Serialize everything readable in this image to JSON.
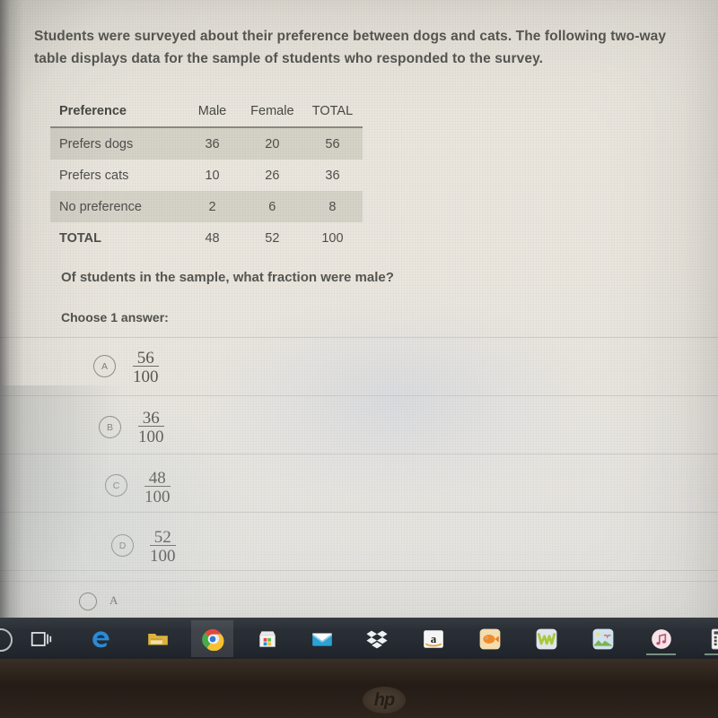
{
  "prompt": "Students were surveyed about their preference between dogs and cats. The following two-way table displays data for the sample of students who responded to the survey.",
  "table": {
    "headers": [
      "Preference",
      "Male",
      "Female",
      "TOTAL"
    ],
    "rows": [
      {
        "label": "Prefers dogs",
        "male": "36",
        "female": "20",
        "total": "56"
      },
      {
        "label": "Prefers cats",
        "male": "10",
        "female": "26",
        "total": "36"
      },
      {
        "label": "No preference",
        "male": "2",
        "female": "6",
        "total": "8"
      },
      {
        "label": "TOTAL",
        "male": "48",
        "female": "52",
        "total": "100"
      }
    ]
  },
  "question": "Of students in the sample, what fraction were male?",
  "choose_label": "Choose 1 answer:",
  "choices": [
    {
      "letter": "A",
      "numerator": "56",
      "denominator": "100"
    },
    {
      "letter": "B",
      "numerator": "36",
      "denominator": "100"
    },
    {
      "letter": "C",
      "numerator": "48",
      "denominator": "100"
    },
    {
      "letter": "D",
      "numerator": "52",
      "denominator": "100"
    }
  ],
  "partial_option": {
    "label": "A"
  },
  "taskbar": {
    "items": [
      {
        "name": "search-icon",
        "label": "Search"
      },
      {
        "name": "task-view-icon",
        "label": "Task View"
      },
      {
        "name": "edge-icon",
        "label": "Microsoft Edge"
      },
      {
        "name": "file-explorer-icon",
        "label": "File Explorer"
      },
      {
        "name": "chrome-icon",
        "label": "Google Chrome"
      },
      {
        "name": "microsoft-store-icon",
        "label": "Microsoft Store"
      },
      {
        "name": "mail-icon",
        "label": "Mail"
      },
      {
        "name": "dropbox-icon",
        "label": "Dropbox"
      },
      {
        "name": "amazon-icon",
        "label": "Amazon"
      },
      {
        "name": "goldfish-app-icon",
        "label": "Goldfish"
      },
      {
        "name": "wattpad-icon",
        "label": "Wattpad"
      },
      {
        "name": "photos-app-icon",
        "label": "Photos"
      },
      {
        "name": "itunes-icon",
        "label": "iTunes"
      },
      {
        "name": "calculator-icon",
        "label": "Calculator"
      }
    ]
  },
  "device": {
    "brand": "hp"
  },
  "colors": {
    "screen_bg": "#e9e5dc",
    "text": "#54544f",
    "table_shade": "#b6b0a1",
    "taskbar_bg": "#272c33",
    "bezel": "#2e241c"
  }
}
